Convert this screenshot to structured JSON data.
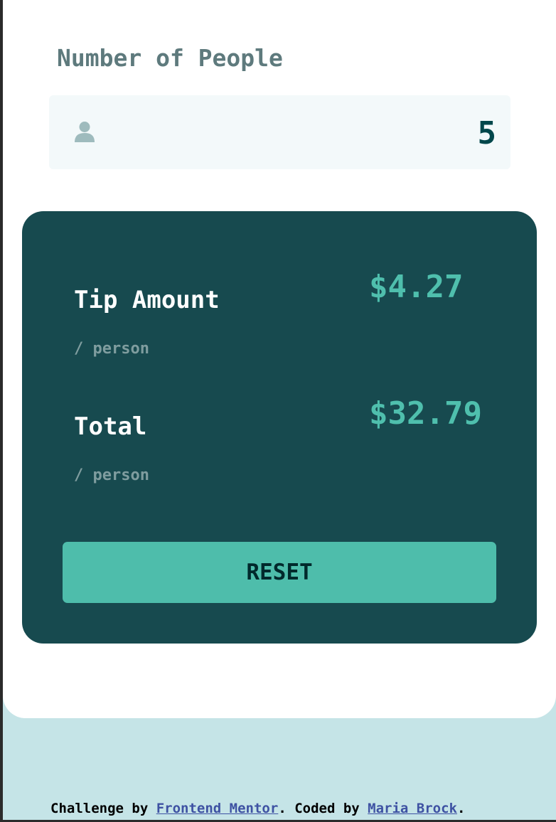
{
  "people": {
    "label": "Number of People",
    "value": "5",
    "icon": "person-icon"
  },
  "results": {
    "tip": {
      "title": "Tip Amount",
      "sub": "/ person",
      "amount": "$4.27"
    },
    "total": {
      "title": "Total",
      "sub": "/ person",
      "amount": "$32.79"
    },
    "reset_label": "RESET"
  },
  "footer": {
    "prefix": "Challenge by ",
    "link1": "Frontend Mentor",
    "middle": ". Coded by ",
    "link2": "Maria Brock",
    "suffix": "."
  },
  "colors": {
    "background": "#c5e4e7",
    "card": "#ffffff",
    "panel": "#174a4f",
    "accent": "#4fbfad",
    "label": "#5e7a7d",
    "value": "#00474b",
    "link": "#3e52a3"
  }
}
